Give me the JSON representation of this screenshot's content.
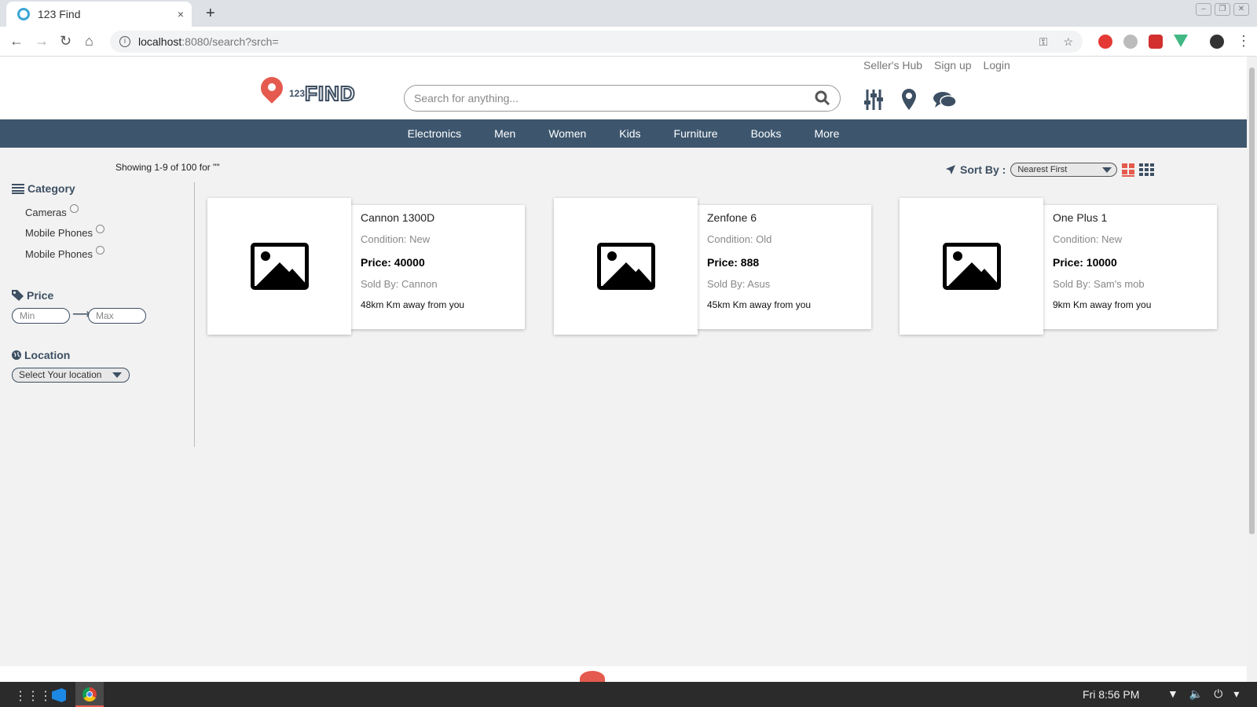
{
  "browser": {
    "tab_title": "123 Find",
    "tab_close": "×",
    "new_tab": "+",
    "url_host": "localhost",
    "url_path": ":8080/search?srch="
  },
  "header": {
    "links": [
      "Seller's Hub",
      "Sign up",
      "Login"
    ],
    "logo_number": "123",
    "logo_word": "FIND",
    "search_placeholder": "Search for anything..."
  },
  "nav": [
    "Electronics",
    "Men",
    "Women",
    "Kids",
    "Furniture",
    "Books",
    "More"
  ],
  "results": {
    "showing": "Showing 1-9 of 100 for \"\"",
    "sort_label": "Sort By :",
    "sort_value": "Nearest First"
  },
  "sidebar": {
    "category_title": "Category",
    "categories": [
      "Cameras",
      "Mobile Phones",
      "Mobile Phones"
    ],
    "price_title": "Price",
    "price_min_placeholder": "Min",
    "price_max_placeholder": "Max",
    "location_title": "Location",
    "location_value": "Select Your location"
  },
  "products": [
    {
      "name": "Cannon 1300D",
      "condition": "Condition: New",
      "price": "Price: 40000",
      "sold_by": "Sold By: Cannon",
      "distance": "48km Km away from you"
    },
    {
      "name": "Zenfone 6",
      "condition": "Condition: Old",
      "price": "Price: 888",
      "sold_by": "Sold By: Asus",
      "distance": "45km Km away from you"
    },
    {
      "name": "One Plus 1",
      "condition": "Condition: New",
      "price": "Price: 10000",
      "sold_by": "Sold By: Sam's mob",
      "distance": "9km Km away from you"
    }
  ],
  "taskbar": {
    "clock": "Fri  8:56 PM"
  },
  "colors": {
    "navbar": "#3d566e",
    "brand_dark": "#3d4f63",
    "brand_red": "#e55a4e"
  },
  "icons": [
    "search-icon",
    "filter-icon",
    "map-pin-icon",
    "chat-icon",
    "grid-view-icon",
    "compact-grid-icon",
    "location-arrow-icon",
    "list-icon",
    "tag-icon",
    "globe-icon",
    "image-placeholder-icon"
  ]
}
